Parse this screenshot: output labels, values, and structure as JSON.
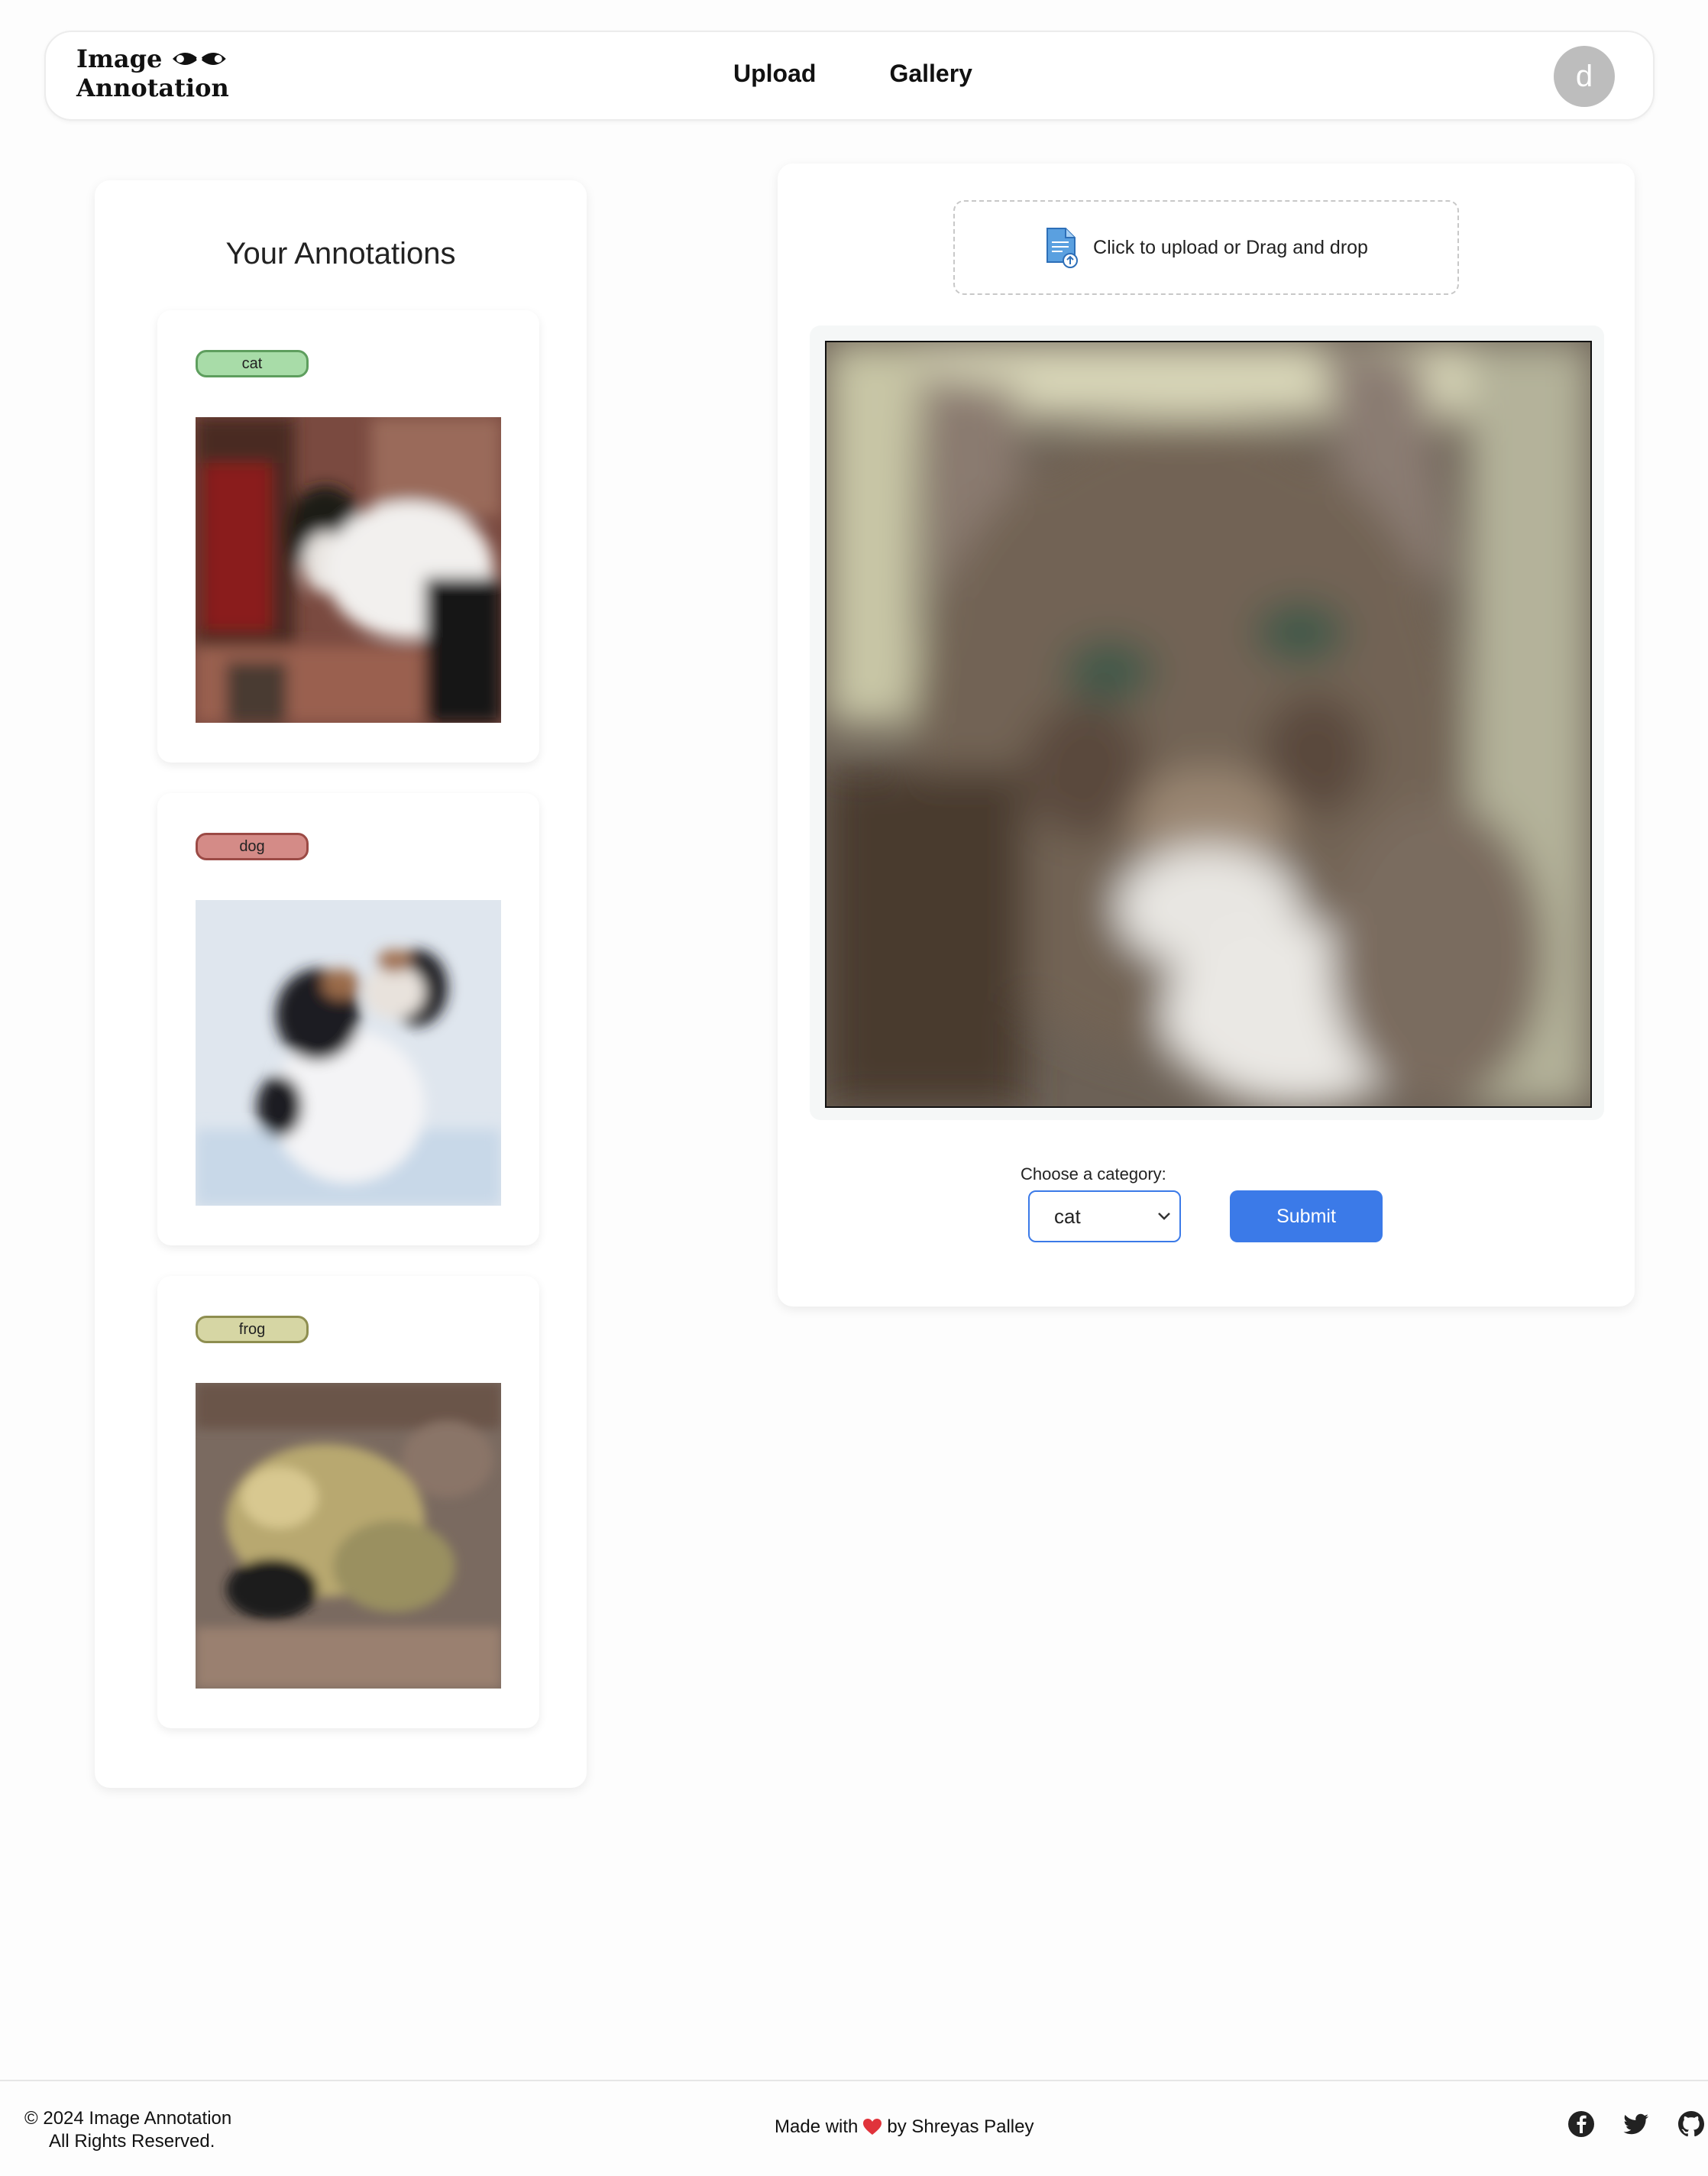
{
  "header": {
    "logo_line1": "Image",
    "logo_line2": "Annotation",
    "nav": [
      {
        "label": "Upload"
      },
      {
        "label": "Gallery"
      }
    ],
    "avatar_initial": "d"
  },
  "annotations": {
    "title": "Your Annotations",
    "items": [
      {
        "label": "cat",
        "image": "cat-thumbnail"
      },
      {
        "label": "dog",
        "image": "dog-thumbnail"
      },
      {
        "label": "frog",
        "image": "frog-thumbnail"
      }
    ]
  },
  "upload": {
    "dropzone_text": "Click to upload or Drag and drop",
    "category_label": "Choose a category:",
    "selected_category": "cat",
    "submit_label": "Submit"
  },
  "footer": {
    "copyright": "© 2024 Image Annotation",
    "rights": "All Rights Reserved.",
    "made_with_prefix": "Made with",
    "made_with_suffix": "by Shreyas Palley",
    "social": [
      "facebook-icon",
      "twitter-icon",
      "github-icon"
    ]
  },
  "colors": {
    "accent": "#3b7ae8",
    "badge_cat": "#a8dca8",
    "badge_dog": "#d48b87",
    "badge_frog": "#d6d6a4"
  }
}
